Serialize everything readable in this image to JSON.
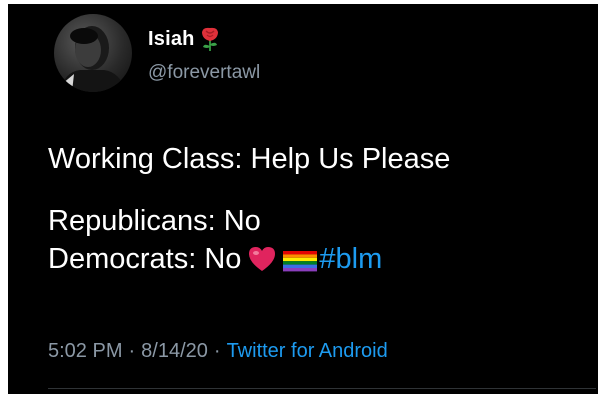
{
  "tweet": {
    "author": {
      "display_name": "Isiah",
      "name_emoji": "rose-icon",
      "handle": "@forevertawl",
      "avatar": "avatar-photo"
    },
    "text": {
      "line1": "Working Class: Help Us Please",
      "line2": "Republicans: No",
      "line3": "Democrats: No",
      "line3_emojis": [
        "red-heart-icon",
        "rainbow-flag-icon"
      ],
      "hashtag": "#blm"
    },
    "meta": {
      "time": "5:02 PM",
      "separator": "·",
      "date": "8/14/20",
      "source": "Twitter for Android"
    }
  },
  "colors": {
    "background": "#000000",
    "text": "#ffffff",
    "muted": "#8b98a5",
    "link": "#1d9bf0",
    "heart": "#e0245e"
  }
}
